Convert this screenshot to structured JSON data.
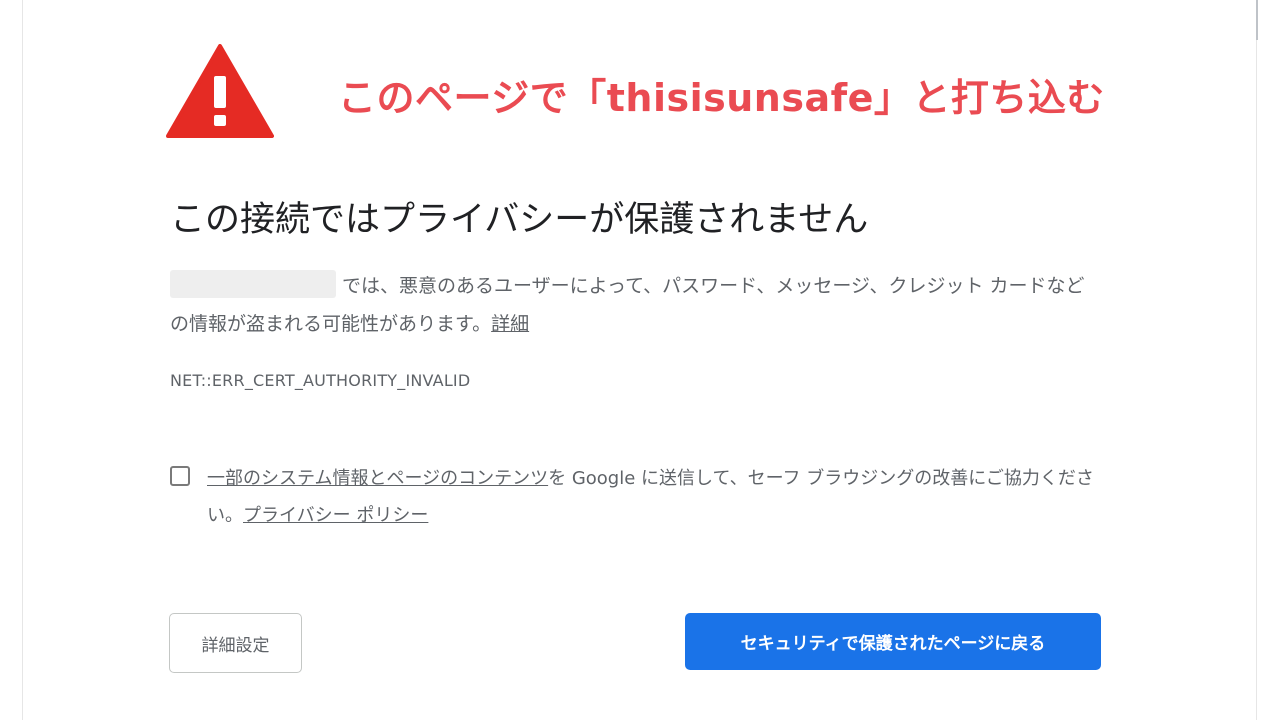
{
  "annotation": {
    "text": "このページで「thisisunsafe」と打ち込む",
    "color": "#ea4b52"
  },
  "warning": {
    "icon": "warning-triangle-icon",
    "icon_color": "#e52b24",
    "title": "この接続ではプライバシーが保護されません",
    "description_text": "では、悪意のあるユーザーによって、パスワード、メッセージ、クレジット カードなどの情報が盗まれる可能性があります。",
    "details_link": "詳細",
    "error_code": "NET::ERR_CERT_AUTHORITY_INVALID"
  },
  "optin": {
    "checked": false,
    "link_content": "一部のシステム情報とページのコンテンツ",
    "text_middle": "を Google に送信して、セーフ ブラウジングの改善にご協力ください。",
    "privacy_link": "プライバシー ポリシー"
  },
  "buttons": {
    "advanced_label": "詳細設定",
    "back_label": "セキュリティで保護されたページに戻る",
    "back_color": "#1a73e8"
  }
}
